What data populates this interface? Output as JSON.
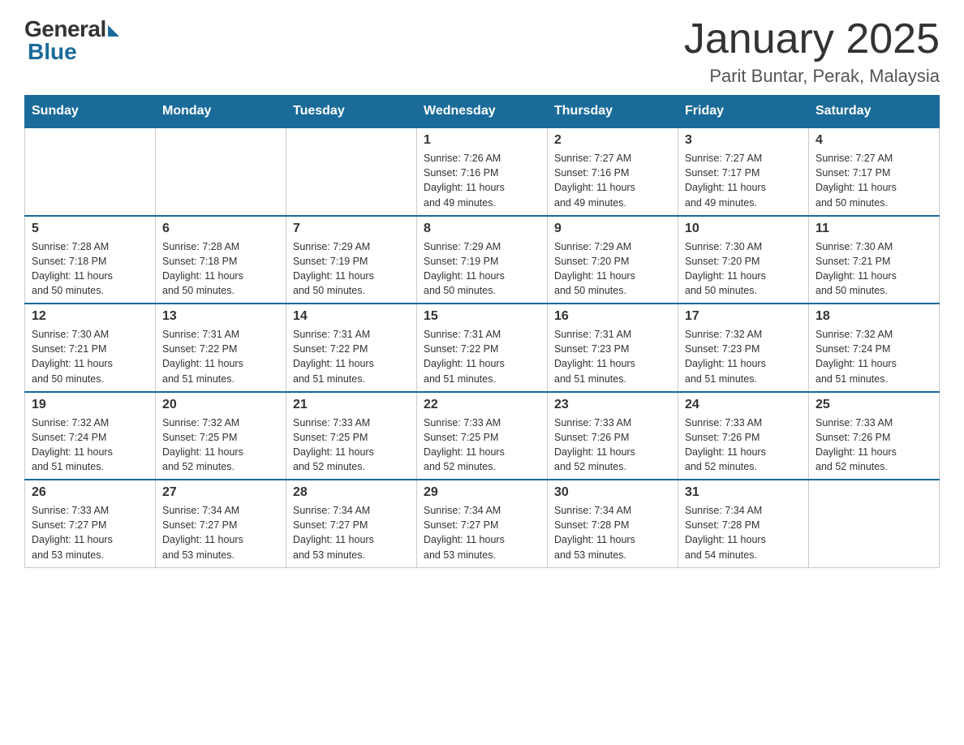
{
  "header": {
    "logo_general": "General",
    "logo_blue": "Blue",
    "month_title": "January 2025",
    "location": "Parit Buntar, Perak, Malaysia"
  },
  "weekdays": [
    "Sunday",
    "Monday",
    "Tuesday",
    "Wednesday",
    "Thursday",
    "Friday",
    "Saturday"
  ],
  "weeks": [
    [
      {
        "day": "",
        "info": ""
      },
      {
        "day": "",
        "info": ""
      },
      {
        "day": "",
        "info": ""
      },
      {
        "day": "1",
        "info": "Sunrise: 7:26 AM\nSunset: 7:16 PM\nDaylight: 11 hours\nand 49 minutes."
      },
      {
        "day": "2",
        "info": "Sunrise: 7:27 AM\nSunset: 7:16 PM\nDaylight: 11 hours\nand 49 minutes."
      },
      {
        "day": "3",
        "info": "Sunrise: 7:27 AM\nSunset: 7:17 PM\nDaylight: 11 hours\nand 49 minutes."
      },
      {
        "day": "4",
        "info": "Sunrise: 7:27 AM\nSunset: 7:17 PM\nDaylight: 11 hours\nand 50 minutes."
      }
    ],
    [
      {
        "day": "5",
        "info": "Sunrise: 7:28 AM\nSunset: 7:18 PM\nDaylight: 11 hours\nand 50 minutes."
      },
      {
        "day": "6",
        "info": "Sunrise: 7:28 AM\nSunset: 7:18 PM\nDaylight: 11 hours\nand 50 minutes."
      },
      {
        "day": "7",
        "info": "Sunrise: 7:29 AM\nSunset: 7:19 PM\nDaylight: 11 hours\nand 50 minutes."
      },
      {
        "day": "8",
        "info": "Sunrise: 7:29 AM\nSunset: 7:19 PM\nDaylight: 11 hours\nand 50 minutes."
      },
      {
        "day": "9",
        "info": "Sunrise: 7:29 AM\nSunset: 7:20 PM\nDaylight: 11 hours\nand 50 minutes."
      },
      {
        "day": "10",
        "info": "Sunrise: 7:30 AM\nSunset: 7:20 PM\nDaylight: 11 hours\nand 50 minutes."
      },
      {
        "day": "11",
        "info": "Sunrise: 7:30 AM\nSunset: 7:21 PM\nDaylight: 11 hours\nand 50 minutes."
      }
    ],
    [
      {
        "day": "12",
        "info": "Sunrise: 7:30 AM\nSunset: 7:21 PM\nDaylight: 11 hours\nand 50 minutes."
      },
      {
        "day": "13",
        "info": "Sunrise: 7:31 AM\nSunset: 7:22 PM\nDaylight: 11 hours\nand 51 minutes."
      },
      {
        "day": "14",
        "info": "Sunrise: 7:31 AM\nSunset: 7:22 PM\nDaylight: 11 hours\nand 51 minutes."
      },
      {
        "day": "15",
        "info": "Sunrise: 7:31 AM\nSunset: 7:22 PM\nDaylight: 11 hours\nand 51 minutes."
      },
      {
        "day": "16",
        "info": "Sunrise: 7:31 AM\nSunset: 7:23 PM\nDaylight: 11 hours\nand 51 minutes."
      },
      {
        "day": "17",
        "info": "Sunrise: 7:32 AM\nSunset: 7:23 PM\nDaylight: 11 hours\nand 51 minutes."
      },
      {
        "day": "18",
        "info": "Sunrise: 7:32 AM\nSunset: 7:24 PM\nDaylight: 11 hours\nand 51 minutes."
      }
    ],
    [
      {
        "day": "19",
        "info": "Sunrise: 7:32 AM\nSunset: 7:24 PM\nDaylight: 11 hours\nand 51 minutes."
      },
      {
        "day": "20",
        "info": "Sunrise: 7:32 AM\nSunset: 7:25 PM\nDaylight: 11 hours\nand 52 minutes."
      },
      {
        "day": "21",
        "info": "Sunrise: 7:33 AM\nSunset: 7:25 PM\nDaylight: 11 hours\nand 52 minutes."
      },
      {
        "day": "22",
        "info": "Sunrise: 7:33 AM\nSunset: 7:25 PM\nDaylight: 11 hours\nand 52 minutes."
      },
      {
        "day": "23",
        "info": "Sunrise: 7:33 AM\nSunset: 7:26 PM\nDaylight: 11 hours\nand 52 minutes."
      },
      {
        "day": "24",
        "info": "Sunrise: 7:33 AM\nSunset: 7:26 PM\nDaylight: 11 hours\nand 52 minutes."
      },
      {
        "day": "25",
        "info": "Sunrise: 7:33 AM\nSunset: 7:26 PM\nDaylight: 11 hours\nand 52 minutes."
      }
    ],
    [
      {
        "day": "26",
        "info": "Sunrise: 7:33 AM\nSunset: 7:27 PM\nDaylight: 11 hours\nand 53 minutes."
      },
      {
        "day": "27",
        "info": "Sunrise: 7:34 AM\nSunset: 7:27 PM\nDaylight: 11 hours\nand 53 minutes."
      },
      {
        "day": "28",
        "info": "Sunrise: 7:34 AM\nSunset: 7:27 PM\nDaylight: 11 hours\nand 53 minutes."
      },
      {
        "day": "29",
        "info": "Sunrise: 7:34 AM\nSunset: 7:27 PM\nDaylight: 11 hours\nand 53 minutes."
      },
      {
        "day": "30",
        "info": "Sunrise: 7:34 AM\nSunset: 7:28 PM\nDaylight: 11 hours\nand 53 minutes."
      },
      {
        "day": "31",
        "info": "Sunrise: 7:34 AM\nSunset: 7:28 PM\nDaylight: 11 hours\nand 54 minutes."
      },
      {
        "day": "",
        "info": ""
      }
    ]
  ]
}
